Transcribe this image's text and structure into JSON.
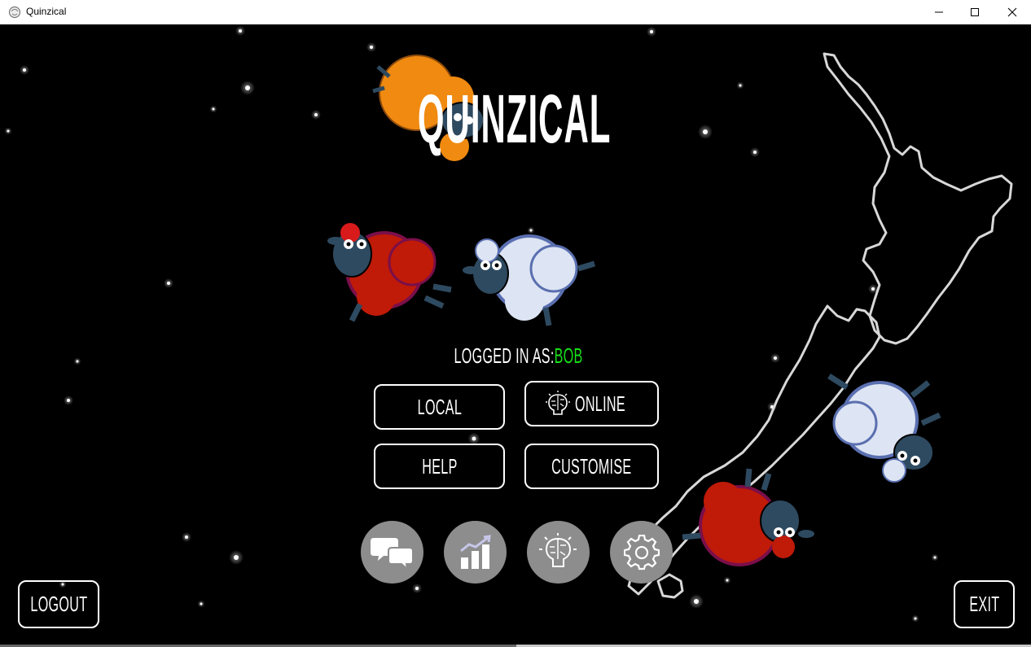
{
  "window": {
    "title": "Quinzical",
    "controls": [
      "minimize",
      "maximize",
      "close"
    ]
  },
  "app": {
    "title": "QUINZICAL",
    "logged_in_label": "LOGGED IN AS:",
    "username": "BOB",
    "username_color": "#19e019"
  },
  "menu": {
    "local": "LOCAL",
    "online": "ONLINE",
    "help": "HELP",
    "customise": "CUSTOMISE"
  },
  "icons": {
    "chat": "chat-bubbles-icon",
    "stats": "bar-chart-icon",
    "brain": "brain-lightbulb-icon",
    "settings": "gear-icon"
  },
  "footer": {
    "logout": "LOGOUT",
    "exit": "EXIT"
  },
  "colors": {
    "background": "#000000",
    "button_border": "#ffffff",
    "round_button": "#8d8d8d",
    "sheep_red": "#c01a08",
    "sheep_white": "#dde4f3",
    "sheep_orange": "#f08a10",
    "sheep_face": "#2e4a60"
  }
}
